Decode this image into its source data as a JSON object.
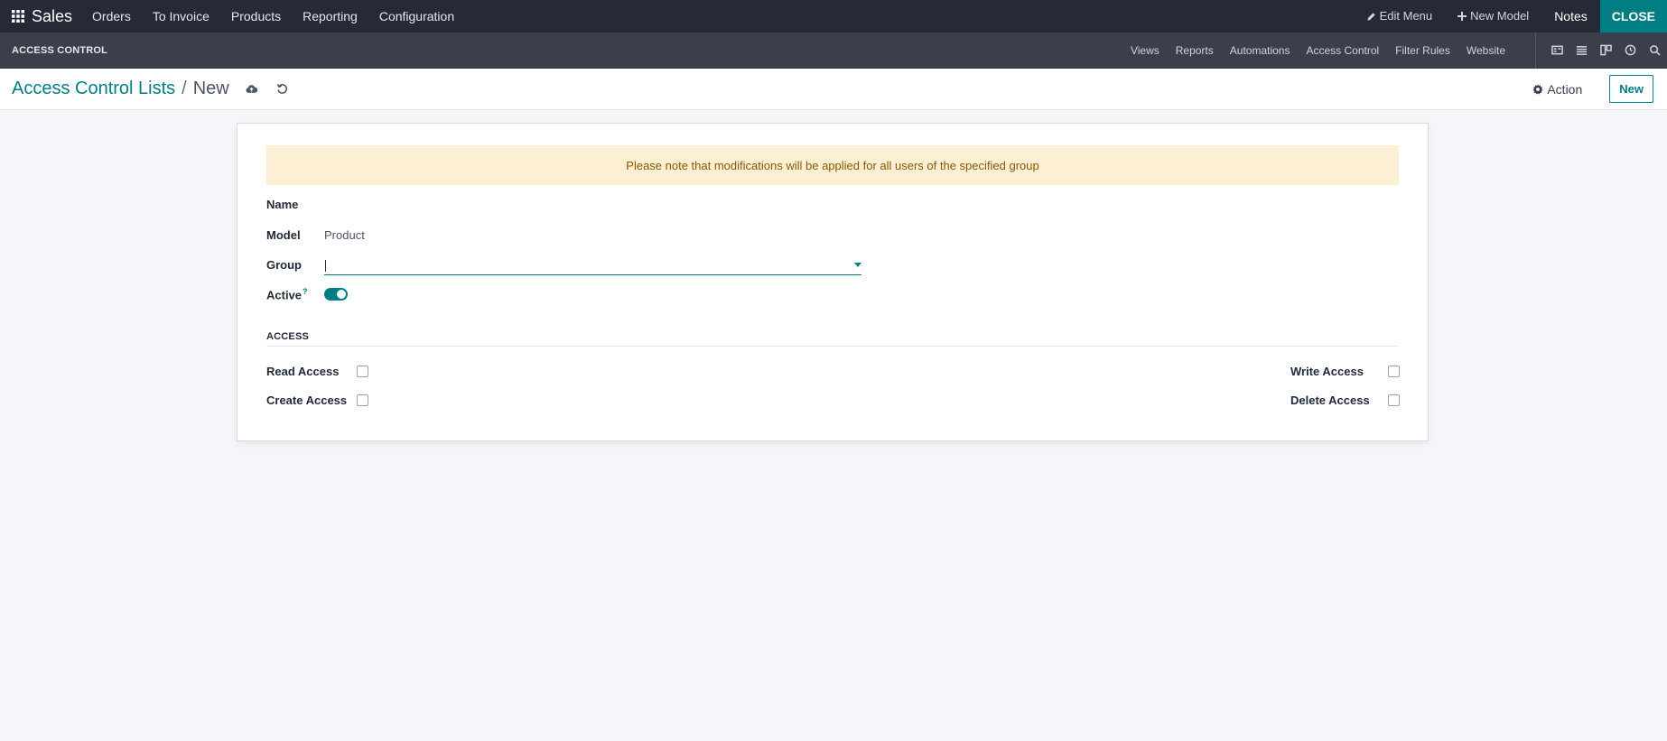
{
  "navbar": {
    "app_name": "Sales",
    "menu": [
      "Orders",
      "To Invoice",
      "Products",
      "Reporting",
      "Configuration"
    ],
    "edit_menu": "Edit Menu",
    "new_model": "New Model",
    "notes": "Notes",
    "close": "CLOSE"
  },
  "studio": {
    "title": "ACCESS CONTROL",
    "tabs": [
      "Views",
      "Reports",
      "Automations",
      "Access Control",
      "Filter Rules",
      "Website"
    ]
  },
  "control_panel": {
    "breadcrumb_parent": "Access Control Lists",
    "breadcrumb_separator": "/",
    "breadcrumb_current": "New",
    "action_label": "Action",
    "new_label": "New"
  },
  "form": {
    "alert": "Please note that modifications will be applied for all users of the specified group",
    "name_label": "Name",
    "name_value": "",
    "model_label": "Model",
    "model_value": "Product",
    "group_label": "Group",
    "group_value": "",
    "active_label": "Active",
    "active_help": "?",
    "active": true,
    "section_title": "ACCESS",
    "read_access_label": "Read Access",
    "create_access_label": "Create Access",
    "write_access_label": "Write Access",
    "delete_access_label": "Delete Access",
    "read_access": false,
    "create_access": false,
    "write_access": false,
    "delete_access": false
  },
  "colors": {
    "accent": "#017e84",
    "navbar_bg": "#262a36",
    "studio_bg": "#3a3f4b",
    "alert_bg": "#fdefd3"
  }
}
